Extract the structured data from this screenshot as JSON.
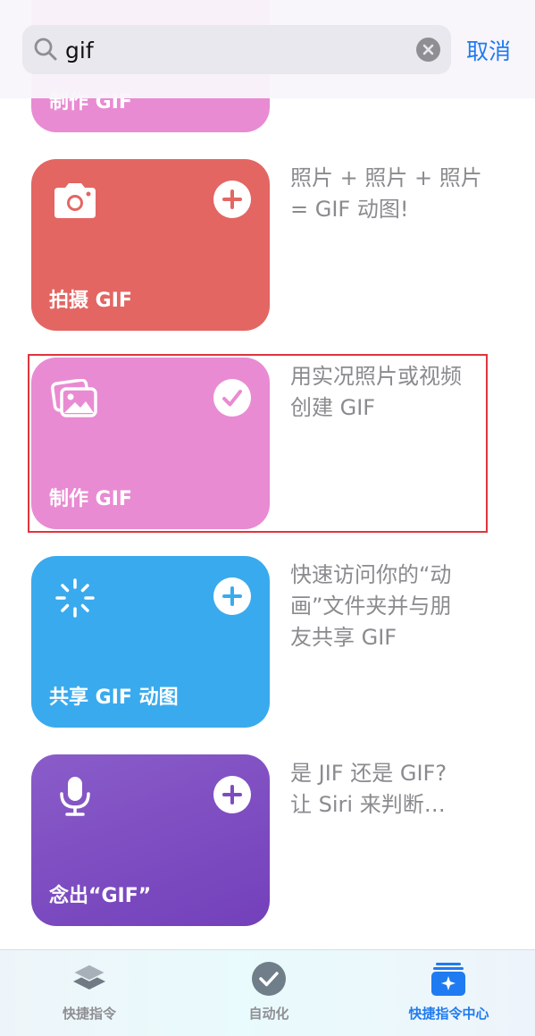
{
  "search": {
    "query": "gif",
    "cancel_label": "取消"
  },
  "shortcuts": [
    {
      "title": "制作 GIF",
      "icon": "photos-icon",
      "color": "#e98bd2",
      "desc": []
    },
    {
      "title": "拍摄 GIF",
      "icon": "camera-icon",
      "color": "#e36663",
      "action": "add",
      "desc": [
        "照片 + 照片 + 照片",
        "= GIF 动图!"
      ]
    },
    {
      "title": "制作 GIF",
      "icon": "photos-icon",
      "color": "#e98bd2",
      "action": "added",
      "desc": [
        "用实况照片或视频",
        "创建 GIF"
      ]
    },
    {
      "title": "共享 GIF 动图",
      "icon": "loading-spinner-icon",
      "color": "#3aaaee",
      "action": "add",
      "desc": [
        "快速访问你的“动",
        "画”文件夹并与朋",
        "友共享 GIF"
      ]
    },
    {
      "title": "念出“GIF”",
      "icon": "microphone-icon",
      "color": "#7d4cc0",
      "action": "add",
      "desc": [
        "是 JIF 还是 GIF?",
        "让 Siri 来判断…"
      ]
    }
  ],
  "tabs": [
    {
      "label": "快捷指令",
      "icon": "layers-icon",
      "active": false
    },
    {
      "label": "自动化",
      "icon": "automation-check-icon",
      "active": false
    },
    {
      "label": "快捷指令中心",
      "icon": "gallery-sparkle-icon",
      "active": true
    }
  ],
  "colors": {
    "accent": "#1f7bf1",
    "tab_inactive": "#8f8f94",
    "highlight_border": "#e0353d"
  }
}
